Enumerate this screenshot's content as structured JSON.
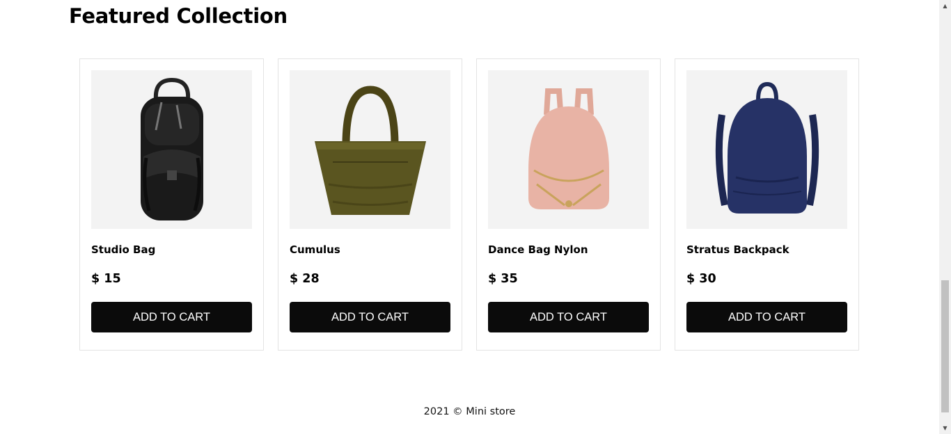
{
  "section": {
    "title": "Featured Collection"
  },
  "products": [
    {
      "name": "Studio Bag",
      "price": "$ 15",
      "button_label": "ADD TO CART",
      "image": "black-backpack-image"
    },
    {
      "name": "Cumulus",
      "price": "$ 28",
      "button_label": "ADD TO CART",
      "image": "olive-tote-bag-image"
    },
    {
      "name": "Dance Bag Nylon",
      "price": "$ 35",
      "button_label": "ADD TO CART",
      "image": "pink-backpack-image"
    },
    {
      "name": "Stratus Backpack",
      "price": "$ 30",
      "button_label": "ADD TO CART",
      "image": "navy-backpack-image"
    }
  ],
  "footer": {
    "text": "2021 © Mini store"
  },
  "colors": {
    "button_bg": "#0b0b0b",
    "card_border": "#e3e3e3",
    "image_bg": "#f3f3f3"
  }
}
